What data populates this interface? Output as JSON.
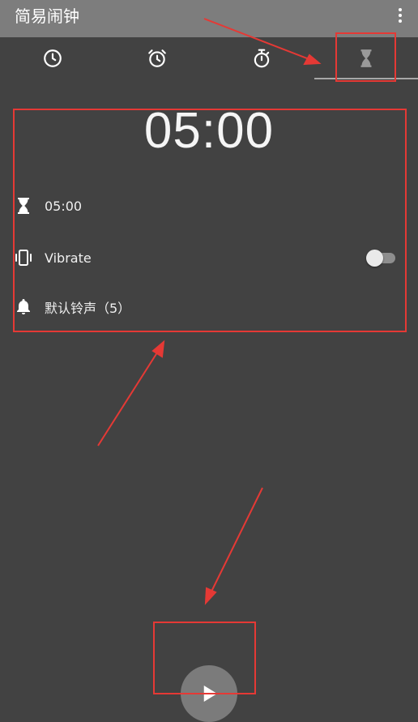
{
  "app": {
    "title": "简易闹钟"
  },
  "tabs": [
    {
      "name": "clock",
      "icon": "clock-icon"
    },
    {
      "name": "alarm",
      "icon": "alarm-clock-icon"
    },
    {
      "name": "stopwatch",
      "icon": "stopwatch-icon"
    },
    {
      "name": "timer",
      "icon": "hourglass-icon",
      "selected": true
    }
  ],
  "timer": {
    "display": "05:00",
    "rows": {
      "duration": {
        "icon": "hourglass-icon",
        "label": "05:00"
      },
      "vibrate": {
        "icon": "vibrate-icon",
        "label": "Vibrate",
        "enabled": false
      },
      "sound": {
        "icon": "bell-icon",
        "label": "默认铃声（5）"
      }
    }
  },
  "fab": {
    "icon": "play-icon"
  },
  "colors": {
    "background": "#424242",
    "appbar": "#7d7d7d",
    "annotation": "#e53935",
    "fab": "#7b7b7b"
  }
}
